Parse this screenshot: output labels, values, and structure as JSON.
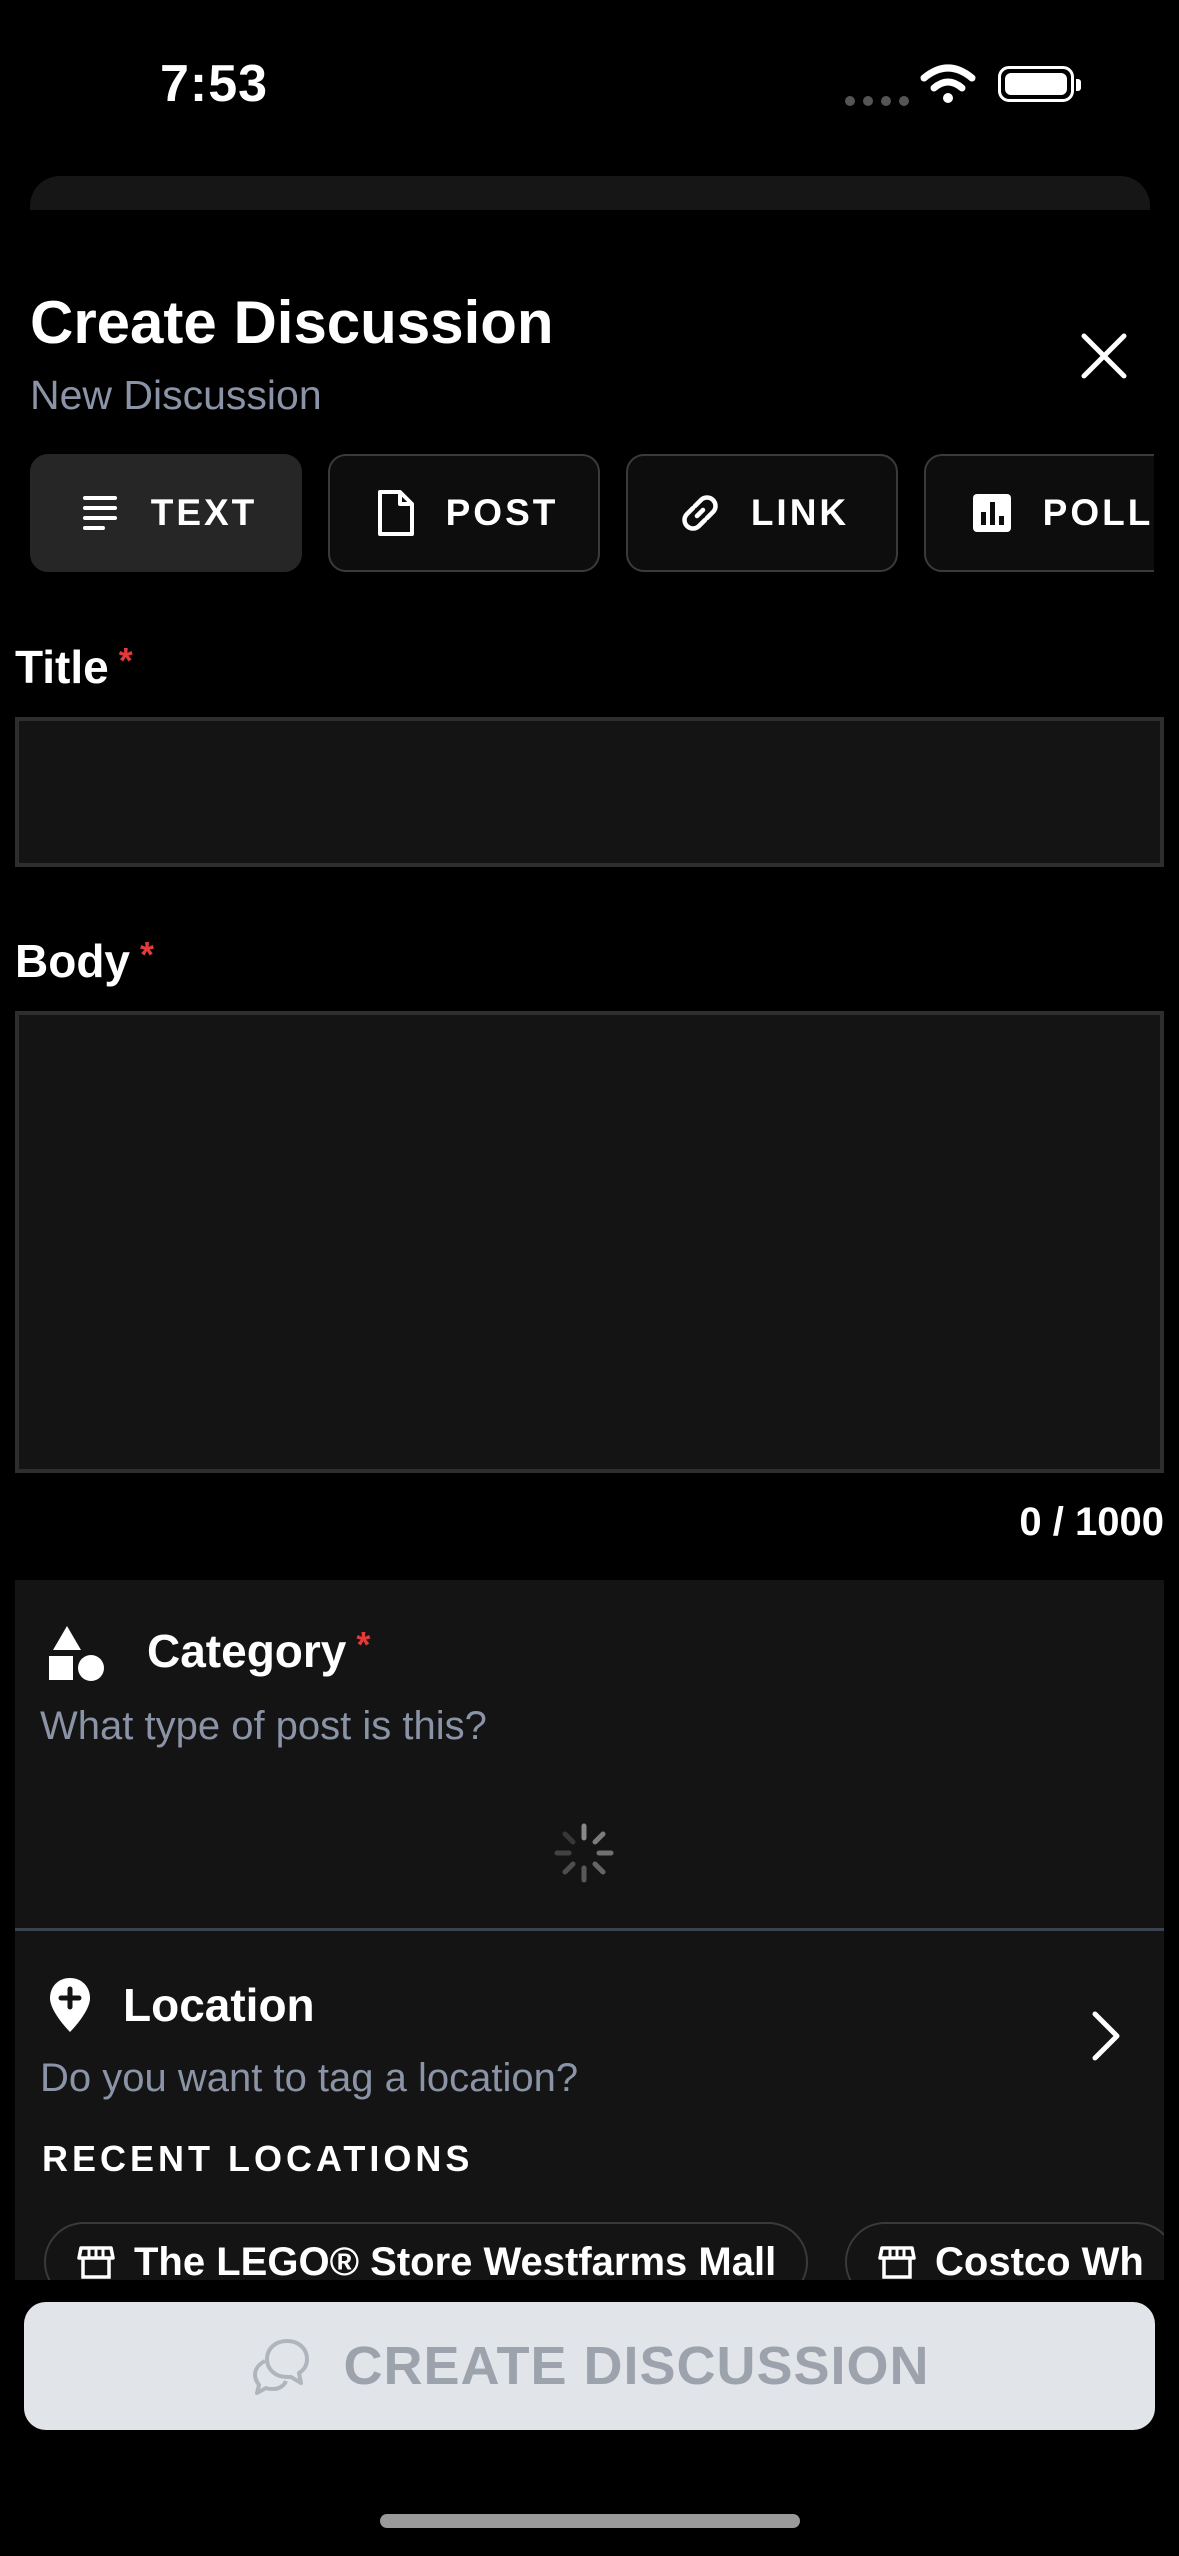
{
  "status_bar": {
    "time": "7:53"
  },
  "header": {
    "title": "Create Discussion",
    "subtitle": "New Discussion"
  },
  "tabs": [
    {
      "label": "TEXT",
      "icon": "text-lines-icon",
      "active": true
    },
    {
      "label": "POST",
      "icon": "document-icon",
      "active": false
    },
    {
      "label": "LINK",
      "icon": "link-icon",
      "active": false
    },
    {
      "label": "POLL",
      "icon": "poll-chart-icon",
      "active": false
    }
  ],
  "form": {
    "title_label": "Title",
    "title_value": "",
    "body_label": "Body",
    "body_value": "",
    "required_mark": "*",
    "counter": "0 / 1000"
  },
  "category": {
    "title": "Category",
    "subtitle": "What type of post is this?",
    "loading": true
  },
  "location": {
    "title": "Location",
    "subtitle": "Do you want to tag a location?",
    "recent_heading": "RECENT LOCATIONS",
    "recent": [
      "The LEGO® Store Westfarms Mall",
      "Costco Wh"
    ]
  },
  "submit": {
    "label": "CREATE DISCUSSION"
  },
  "colors": {
    "background": "#000000",
    "panel": "#141414",
    "required": "#e23b3b",
    "muted": "#8b93a6",
    "button": "#e1e4e8"
  }
}
